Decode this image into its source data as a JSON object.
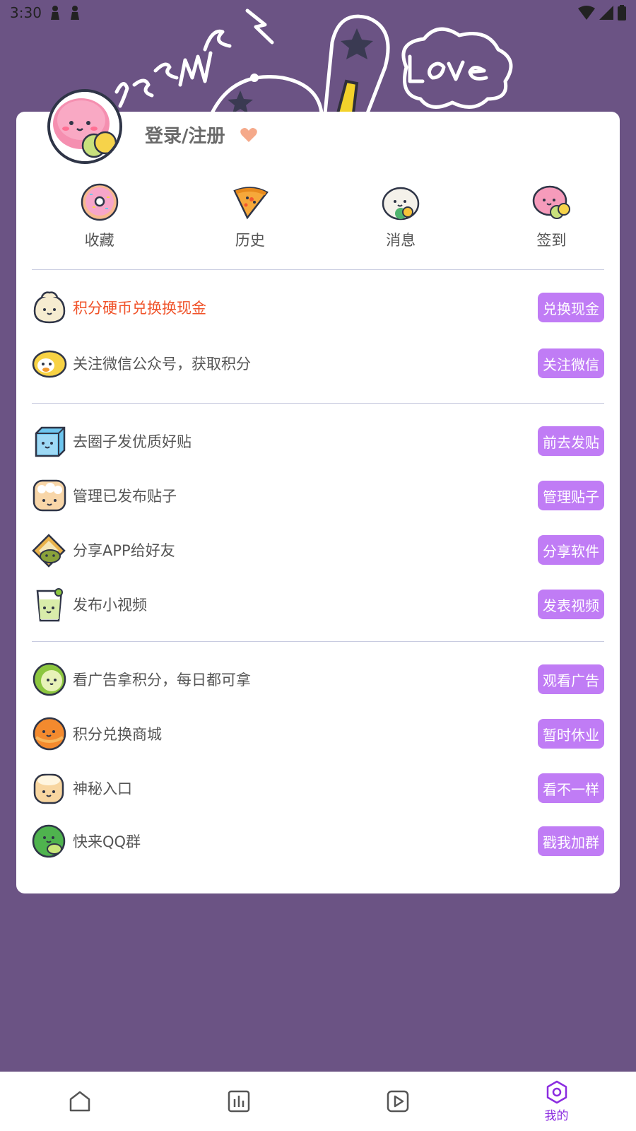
{
  "status_bar": {
    "time": "3:30"
  },
  "profile": {
    "login_label": "登录/注册"
  },
  "quick_actions": [
    {
      "label": "收藏",
      "icon": "donut-icon"
    },
    {
      "label": "历史",
      "icon": "pizza-icon"
    },
    {
      "label": "消息",
      "icon": "rice-ball-icon"
    },
    {
      "label": "签到",
      "icon": "mochi-icon"
    }
  ],
  "section1": [
    {
      "text": "积分硬币兑换换现金",
      "button": "兑换现金",
      "icon": "dumpling-icon",
      "highlight": true
    },
    {
      "text": "关注微信公众号，获取积分",
      "button": "关注微信",
      "icon": "lemon-icon"
    }
  ],
  "section2": [
    {
      "text": "去圈子发优质好贴",
      "button": "前去发贴",
      "icon": "ice-cube-icon"
    },
    {
      "text": "管理已发布贴子",
      "button": "管理贴子",
      "icon": "bun-icon"
    },
    {
      "text": "分享APP给好友",
      "button": "分享软件",
      "icon": "toast-icon"
    },
    {
      "text": "发布小视频",
      "button": "发表视频",
      "icon": "juice-cup-icon"
    }
  ],
  "section3": [
    {
      "text": "看广告拿积分，每日都可拿",
      "button": "观看广告",
      "icon": "melon-icon"
    },
    {
      "text": "积分兑换商城",
      "button": "暂时休业",
      "icon": "orange-cookie-icon"
    },
    {
      "text": "神秘入口",
      "button": "看不一样",
      "icon": "pudding-icon"
    },
    {
      "text": "快来QQ群",
      "button": "戳我加群",
      "icon": "lime-icon"
    }
  ],
  "bottom_nav": [
    {
      "icon": "home-icon"
    },
    {
      "icon": "chart-icon"
    },
    {
      "icon": "play-icon"
    },
    {
      "icon": "hexagon-icon",
      "label": "我的",
      "active": true
    }
  ],
  "colors": {
    "background": "#6b5384",
    "button": "#c07cf5",
    "highlight_text": "#f0532a",
    "nav_active": "#8b2ce0"
  }
}
